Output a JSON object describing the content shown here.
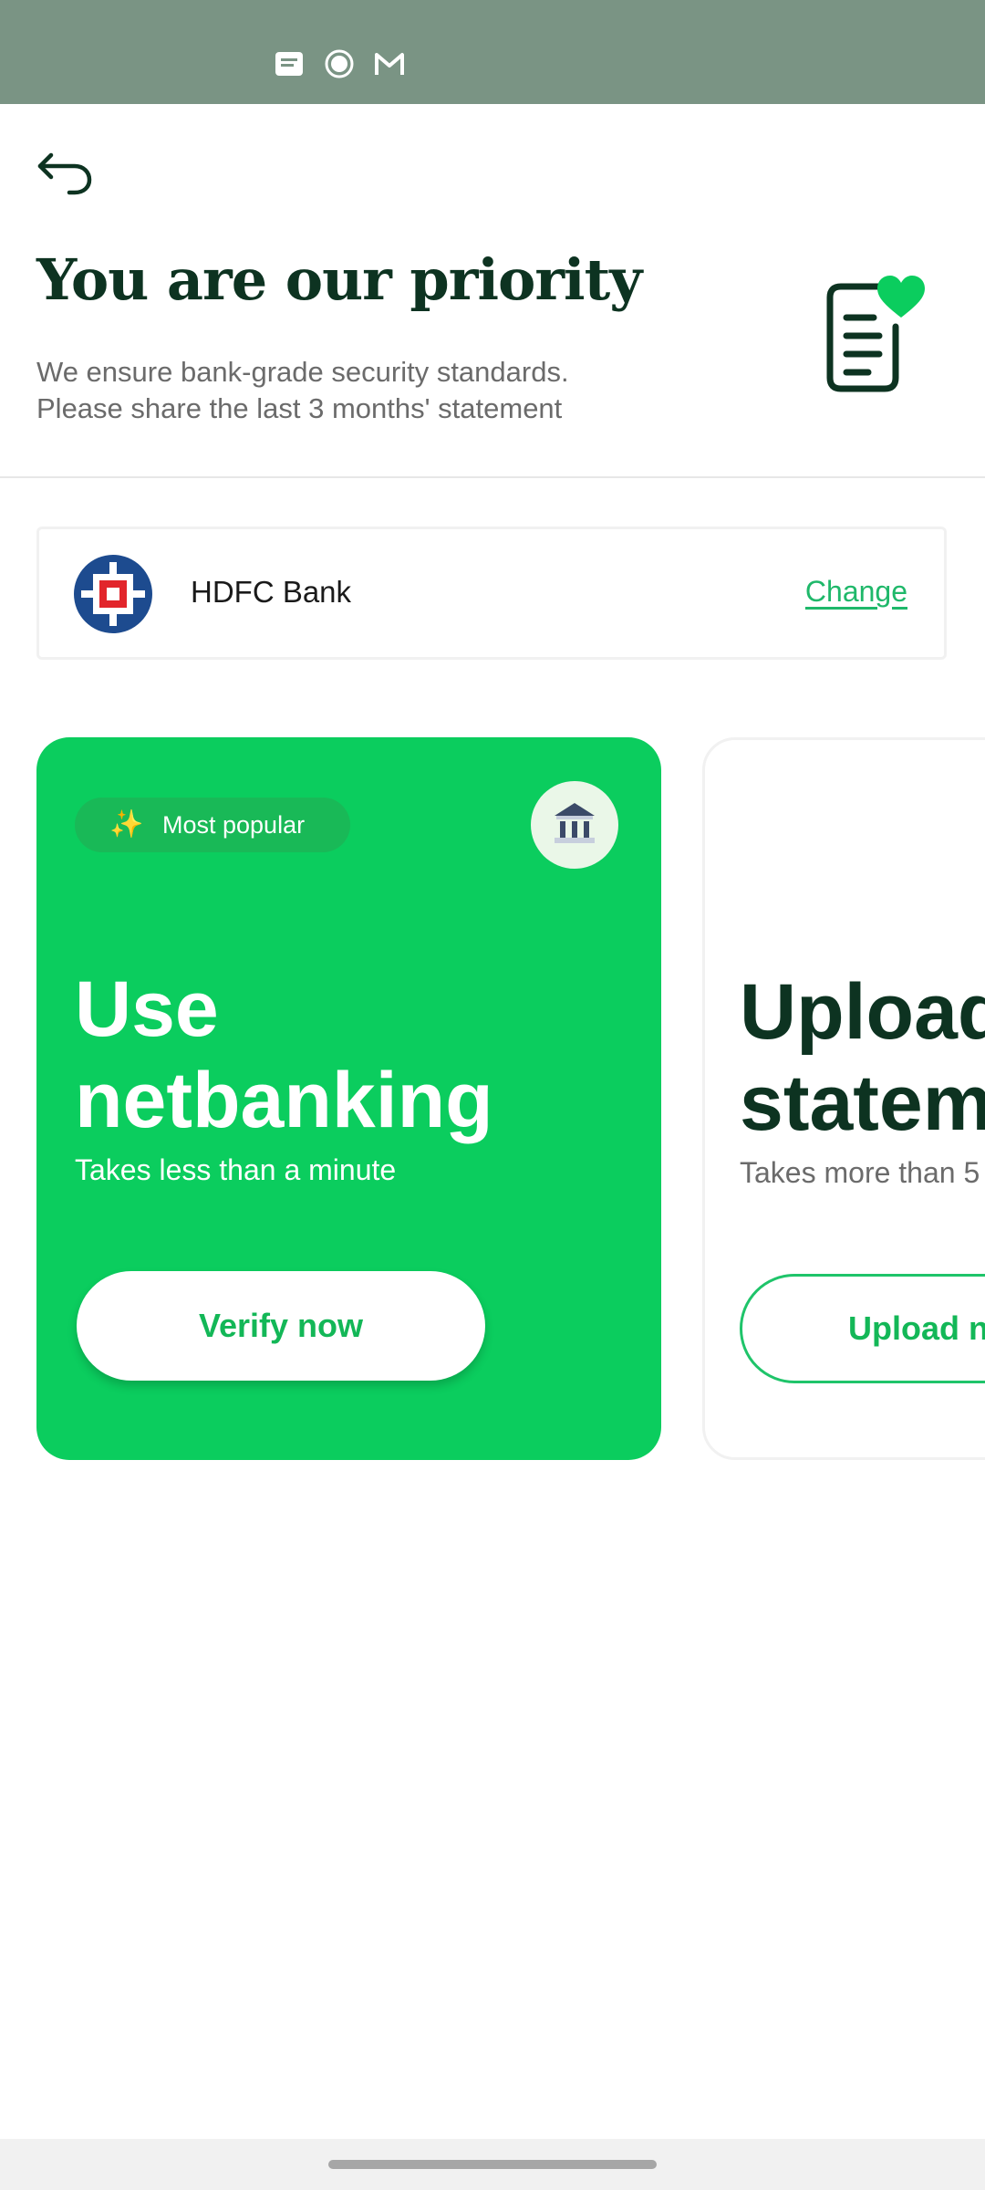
{
  "status_bar": {
    "icons": [
      "message-icon",
      "record-icon",
      "gmail-icon"
    ]
  },
  "header": {
    "title": "You are our priority",
    "subtitle_line1": "We ensure bank-grade security standards.",
    "subtitle_line2": "Please share the last 3 months' statement"
  },
  "bank": {
    "name": "HDFC Bank",
    "change_label": "Change"
  },
  "options": [
    {
      "badge": "Most popular",
      "title_line1": "Use",
      "title_line2": "netbanking",
      "subtitle": "Takes less than a minute",
      "button": "Verify now"
    },
    {
      "title_line1": "Upload",
      "title_line2": "statement",
      "subtitle": "Takes more than 5",
      "button": "Upload n"
    }
  ],
  "colors": {
    "accent_green": "#0bcd5e",
    "dark_green": "#0d3321",
    "status_bar": "#7a9484"
  }
}
